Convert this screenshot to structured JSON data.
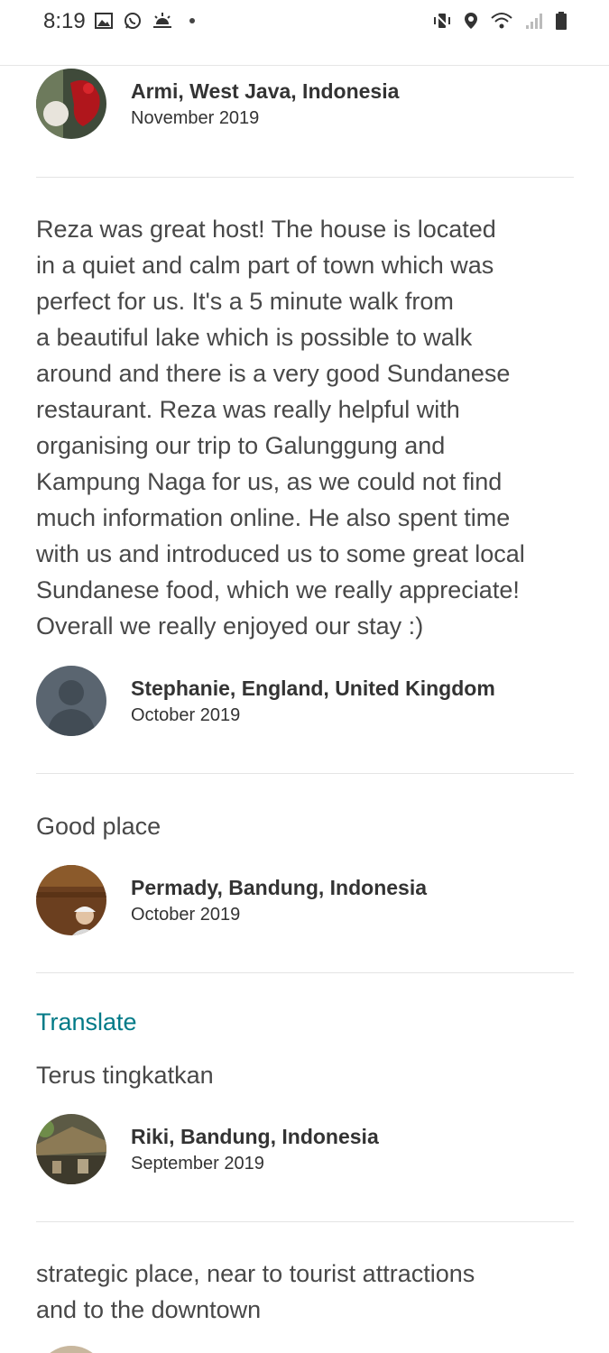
{
  "status_bar": {
    "time": "8:19",
    "left_icons": [
      "gallery-icon",
      "whatsapp-icon",
      "sunrise-icon",
      "dot"
    ],
    "right_icons": [
      "vibrate-icon",
      "location-icon",
      "wifi-icon",
      "signal-icon",
      "battery-icon"
    ]
  },
  "reviews": [
    {
      "id": "armi",
      "name": "Armi, West Java, Indonesia",
      "date": "November 2019",
      "text": "Reza was great host! The house is located in a quiet and calm part of town which was perfect for us. It's a 5 minute walk from a beautiful lake which is possible to walk around and there is a very good Sundanese restaurant. Reza was really helpful with organising our trip to Galunggung and Kampung Naga for us, as we could not find much information online. He also spent time with us and introduced us to some great local Sundanese food, which we really appreciate! Overall we really enjoyed our stay :)",
      "text_lines": [
        "Reza was great host! The house is located",
        "in a quiet and calm part of town which was",
        "perfect for us. It's a 5 minute walk from",
        "a beautiful lake which is possible to walk",
        "around and there is a very good Sundanese",
        "restaurant. Reza was really helpful with",
        "organising our trip to Galunggung and",
        "Kampung Naga for us, as we could not find",
        "much information online. He also spent time",
        "with us and introduced us to some great local",
        "Sundanese food, which we really appreciate!",
        "Overall we really enjoyed our stay :)"
      ]
    },
    {
      "id": "stephanie",
      "name": "Stephanie, England, United Kingdom",
      "date": "October 2019",
      "text": "Good place"
    },
    {
      "id": "permady",
      "name": "Permady, Bandung, Indonesia",
      "date": "October 2019",
      "translate_label": "Translate",
      "text": "Terus tingkatkan"
    },
    {
      "id": "riki",
      "name": "Riki, Bandung, Indonesia",
      "date": "September 2019",
      "text_lines": [
        "strategic place,  near to tourist attractions",
        "and to the downtown"
      ]
    }
  ],
  "colors": {
    "link": "#007a87",
    "text": "#484848",
    "divider": "#e4e4e4"
  }
}
